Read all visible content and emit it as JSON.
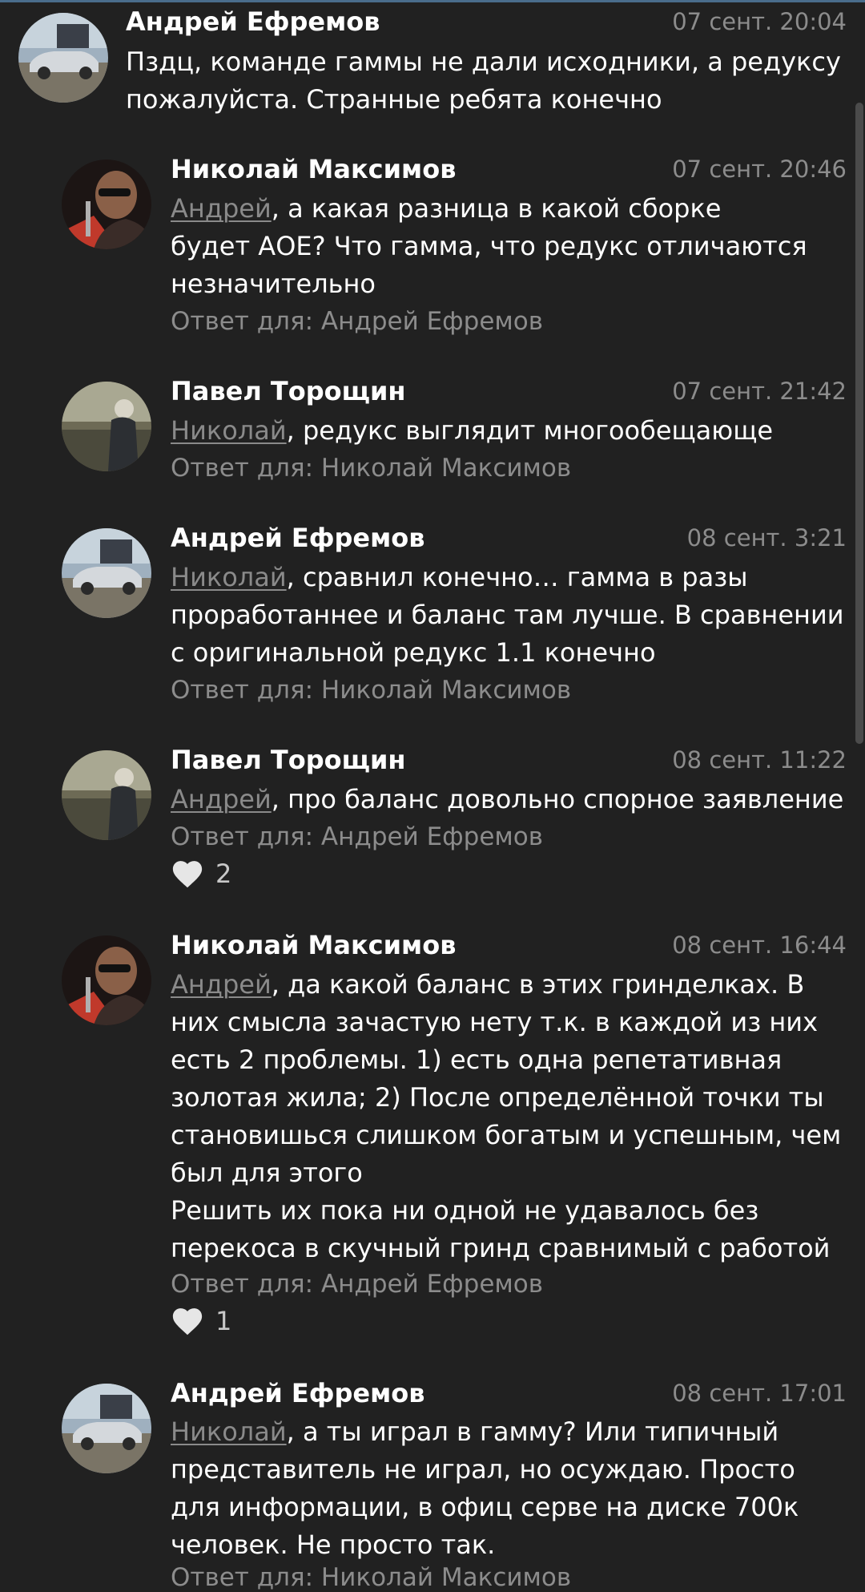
{
  "comments": [
    {
      "author": "Андрей Ефремов",
      "date": "07 сент. 20:04",
      "mention": "",
      "text_lines": [
        "Пздц, команде гаммы не дали исходники, а редуксу",
        "пожалуйста. Странные ребята конечно"
      ],
      "reply_to": "",
      "likes": "",
      "avatar": "car-avatar"
    },
    {
      "author": "Николай Максимов",
      "date": "07 сент. 20:46",
      "mention": "Андрей",
      "text_lines": [
        ", а какая разница в какой сборке",
        "будет АОЕ? Что гамма, что редукс отличаются",
        "незначительно"
      ],
      "reply_to": "Ответ для: Андрей Ефремов",
      "likes": "",
      "avatar": "man-sunglasses-avatar"
    },
    {
      "author": "Павел Торощин",
      "date": "07 сент. 21:42",
      "mention": "Николай",
      "text_lines": [
        ", редукс выглядит многообещающе"
      ],
      "reply_to": "Ответ для: Николай Максимов",
      "likes": "",
      "avatar": "person-outdoors-avatar"
    },
    {
      "author": "Андрей Ефремов",
      "date": "08 сент. 3:21",
      "mention": "Николай",
      "text_lines": [
        ", сравнил конечно… гамма в разы",
        "проработаннее и баланс там лучше. В сравнении",
        "с оригинальной редукс 1.1 конечно"
      ],
      "reply_to": "Ответ для: Николай Максимов",
      "likes": "",
      "avatar": "car-avatar"
    },
    {
      "author": "Павел Торощин",
      "date": "08 сент. 11:22",
      "mention": "Андрей",
      "text_lines": [
        ", про баланс довольно спорное заявление"
      ],
      "reply_to": "Ответ для: Андрей Ефремов",
      "likes": "2",
      "avatar": "person-outdoors-avatar"
    },
    {
      "author": "Николай Максимов",
      "date": "08 сент. 16:44",
      "mention": "Андрей",
      "text_lines": [
        ", да какой баланс в этих гринделках. В",
        "них смысла зачастую нету т.к. в каждой из них",
        "есть 2 проблемы. 1) есть одна репетативная",
        "золотая жила; 2) После определённой точки ты",
        "становишься слишком богатым и успешным, чем",
        "был для этого",
        "Решить их пока ни одной не удавалось без",
        "перекоса в скучный гринд сравнимый с работой"
      ],
      "reply_to": "Ответ для: Андрей Ефремов",
      "likes": "1",
      "avatar": "man-sunglasses-avatar"
    },
    {
      "author": "Андрей Ефремов",
      "date": "08 сент. 17:01",
      "mention": "Николай",
      "text_lines": [
        ", а ты играл в гамму? Или типичный",
        "представитель не играл, но осуждаю. Просто",
        "для информации, в офиц серве на диске 700к",
        "человек. Не просто так."
      ],
      "reply_to": "Ответ для: Николай Максимов",
      "likes": "",
      "avatar": "car-avatar"
    }
  ],
  "colors": {
    "background": "#212121",
    "text": "#ffffff",
    "secondary": "#8c8c8c",
    "heart": "#e6e6e6"
  },
  "icons": {
    "like": "heart-icon"
  }
}
